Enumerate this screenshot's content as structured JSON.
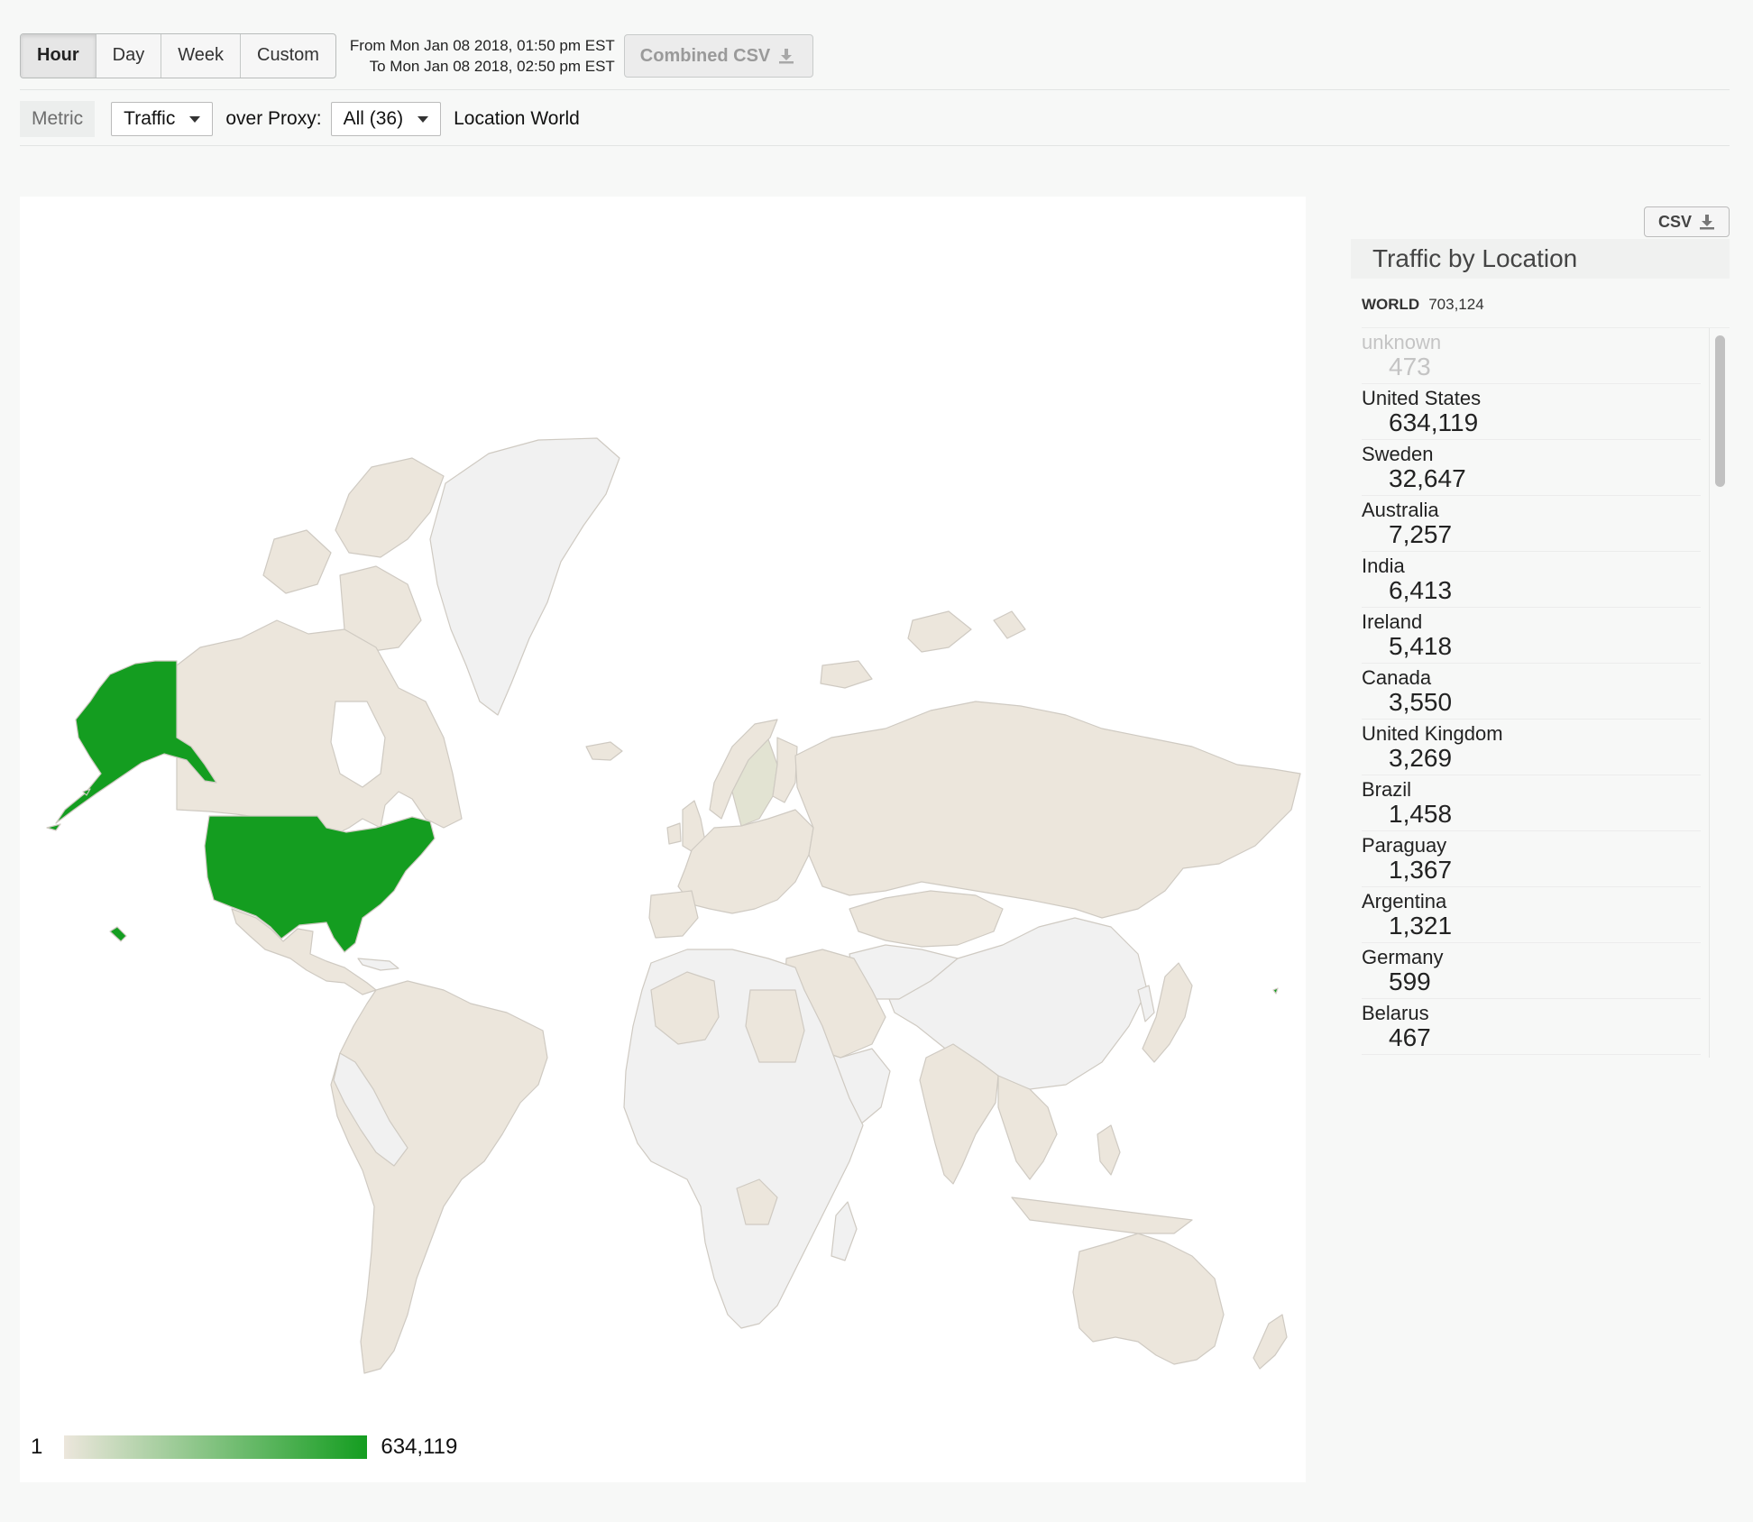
{
  "toolbar": {
    "tabs": [
      "Hour",
      "Day",
      "Week",
      "Custom"
    ],
    "active_tab": "Hour",
    "range_from": "From Mon Jan 08 2018, 01:50 pm EST",
    "range_to": "To Mon Jan 08 2018, 02:50 pm EST",
    "combined_csv_label": "Combined CSV"
  },
  "filters": {
    "metric_label": "Metric",
    "metric_value": "Traffic",
    "over_proxy_label": "over Proxy:",
    "proxy_value": "All (36)",
    "location_text": "Location World"
  },
  "map": {
    "colors": {
      "highlight": "#149d20",
      "low": "#ece6dc",
      "nodata": "#f1f1f1",
      "sweden": "#e2e3d2",
      "border": "#cfcac2"
    },
    "legend_min": "1",
    "legend_max": "634,119"
  },
  "sidebar": {
    "csv_label": "CSV",
    "title": "Traffic by Location",
    "world_label": "WORLD",
    "world_total": "703,124",
    "locations": [
      {
        "name": "unknown",
        "value": "473"
      },
      {
        "name": "United States",
        "value": "634,119"
      },
      {
        "name": "Sweden",
        "value": "32,647"
      },
      {
        "name": "Australia",
        "value": "7,257"
      },
      {
        "name": "India",
        "value": "6,413"
      },
      {
        "name": "Ireland",
        "value": "5,418"
      },
      {
        "name": "Canada",
        "value": "3,550"
      },
      {
        "name": "United Kingdom",
        "value": "3,269"
      },
      {
        "name": "Brazil",
        "value": "1,458"
      },
      {
        "name": "Paraguay",
        "value": "1,367"
      },
      {
        "name": "Argentina",
        "value": "1,321"
      },
      {
        "name": "Germany",
        "value": "599"
      },
      {
        "name": "Belarus",
        "value": "467"
      }
    ]
  }
}
